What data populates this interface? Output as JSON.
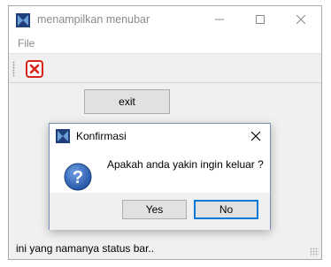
{
  "window": {
    "title": "menampilkan menubar",
    "controls": {
      "minimize": "minimize-icon",
      "maximize": "maximize-icon",
      "close": "close-icon"
    }
  },
  "menubar": {
    "items": [
      {
        "label": "File"
      }
    ]
  },
  "toolbar": {
    "items": [
      {
        "icon": "exit-x-icon"
      }
    ]
  },
  "main": {
    "exit_button_label": "exit"
  },
  "statusbar": {
    "text": "ini yang namanya status bar.."
  },
  "dialog": {
    "title": "Konfirmasi",
    "message": "Apakah anda yakin ingin keluar ?",
    "icon": "question-icon",
    "buttons": {
      "yes": "Yes",
      "no": "No"
    }
  },
  "colors": {
    "accent": "#0078d7",
    "tool_icon_red": "#d9231a",
    "question_icon_blue": "#2a5caa"
  }
}
